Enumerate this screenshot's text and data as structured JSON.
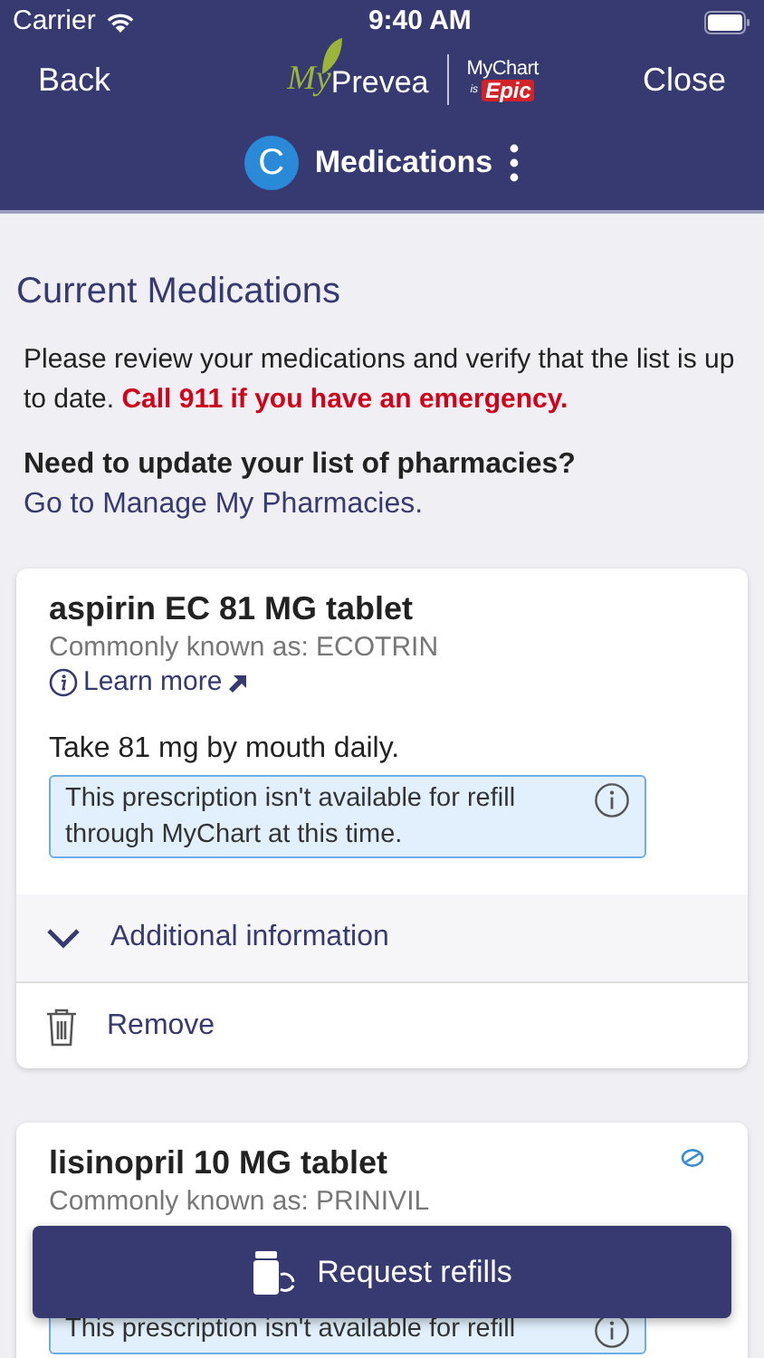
{
  "status_bar": {
    "carrier": "Carrier",
    "time": "9:40 AM"
  },
  "nav": {
    "back": "Back",
    "close": "Close",
    "logo_left": "My",
    "logo_right": "Prevea",
    "logo_mychart": "MyChart",
    "logo_is": "is",
    "logo_epic": "Epic"
  },
  "subheader": {
    "avatar_letter": "C",
    "title": "Medications"
  },
  "page_title": "Current Medications",
  "intro": "Please review your medications and verify that the list is up to date. **Call 911 if you have an emergency.**",
  "pharmacy_prompt": "Need to update your list of pharmacies?",
  "pharmacy_link": "Go to Manage My Pharmacies.",
  "medications": [
    {
      "name": "aspirin EC 81 MG tablet",
      "known_as": "Commonly known as: ECOTRIN",
      "learn_more": "Learn more",
      "instructions": "Take 81 mg by mouth daily.",
      "notice": "This prescription isn't available for refill through MyChart at this time.",
      "pill_icon": false,
      "additional_info": "Additional information",
      "expanded": false,
      "remove": "Remove"
    },
    {
      "name": "lisinopril 10 MG tablet",
      "known_as": "Commonly known as: PRINIVIL",
      "notice": "This prescription isn't available for refill",
      "pill_icon": true
    }
  ],
  "request_button": "Request refills"
}
